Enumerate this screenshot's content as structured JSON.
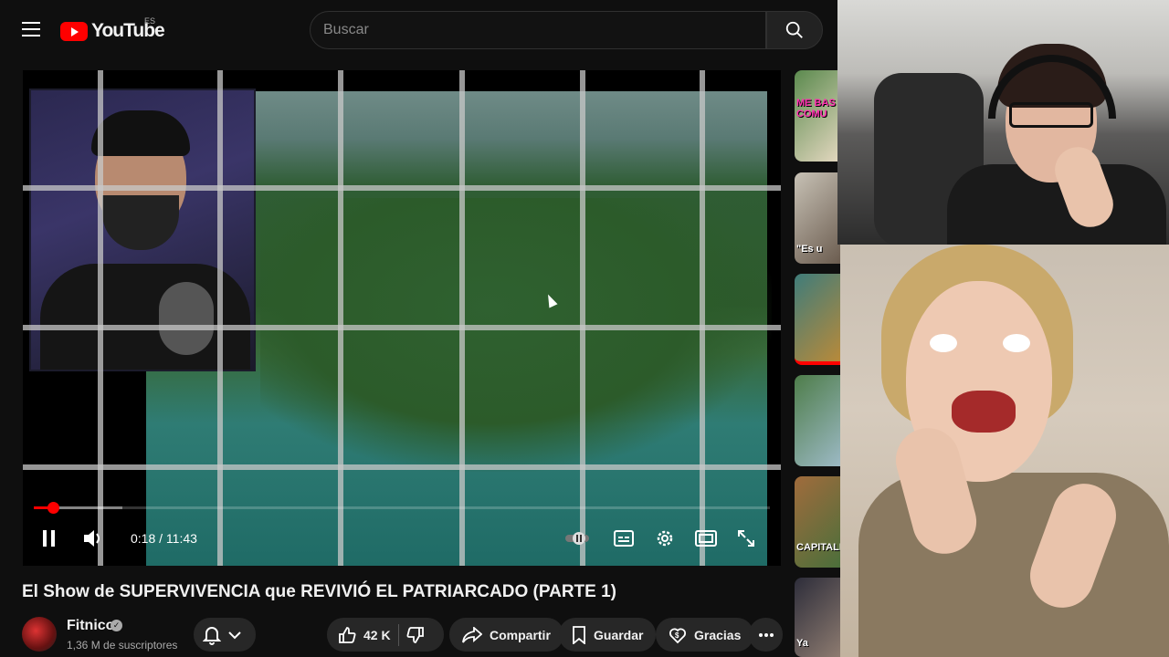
{
  "header": {
    "logo_text": "YouTube",
    "country": "ES",
    "search_placeholder": "Buscar"
  },
  "player": {
    "current_time": "0:18",
    "duration": "11:43",
    "time_display": "0:18 / 11:43",
    "progress_fraction": 0.026,
    "buffer_fraction": 0.12
  },
  "video": {
    "title": "El Show de SUPERVIVENCIA que REVIVIÓ EL PATRIARCADO (PARTE 1)",
    "channel": "Fitnico",
    "subscribers": "1,36 M de suscriptores",
    "likes": "42 K",
    "share_label": "Compartir",
    "save_label": "Guardar",
    "thanks_label": "Gracias"
  },
  "sidebar": {
    "thumb_tags": [
      "ME BAS COMU",
      "\"Es u",
      "",
      "",
      "CAPITALIS",
      "Ya"
    ]
  },
  "colors": {
    "brand": "#ff0000",
    "background": "#0f0f0f",
    "pill": "#272727"
  },
  "icons": [
    "menu-icon",
    "youtube-logo-icon",
    "search-icon",
    "pause-icon",
    "volume-icon",
    "autoplay-icon",
    "subtitles-icon",
    "settings-icon",
    "theater-icon",
    "fullscreen-icon",
    "bell-icon",
    "chevron-down-icon",
    "like-icon",
    "dislike-icon",
    "share-icon",
    "save-icon",
    "thanks-icon",
    "more-icon",
    "verified-icon"
  ]
}
